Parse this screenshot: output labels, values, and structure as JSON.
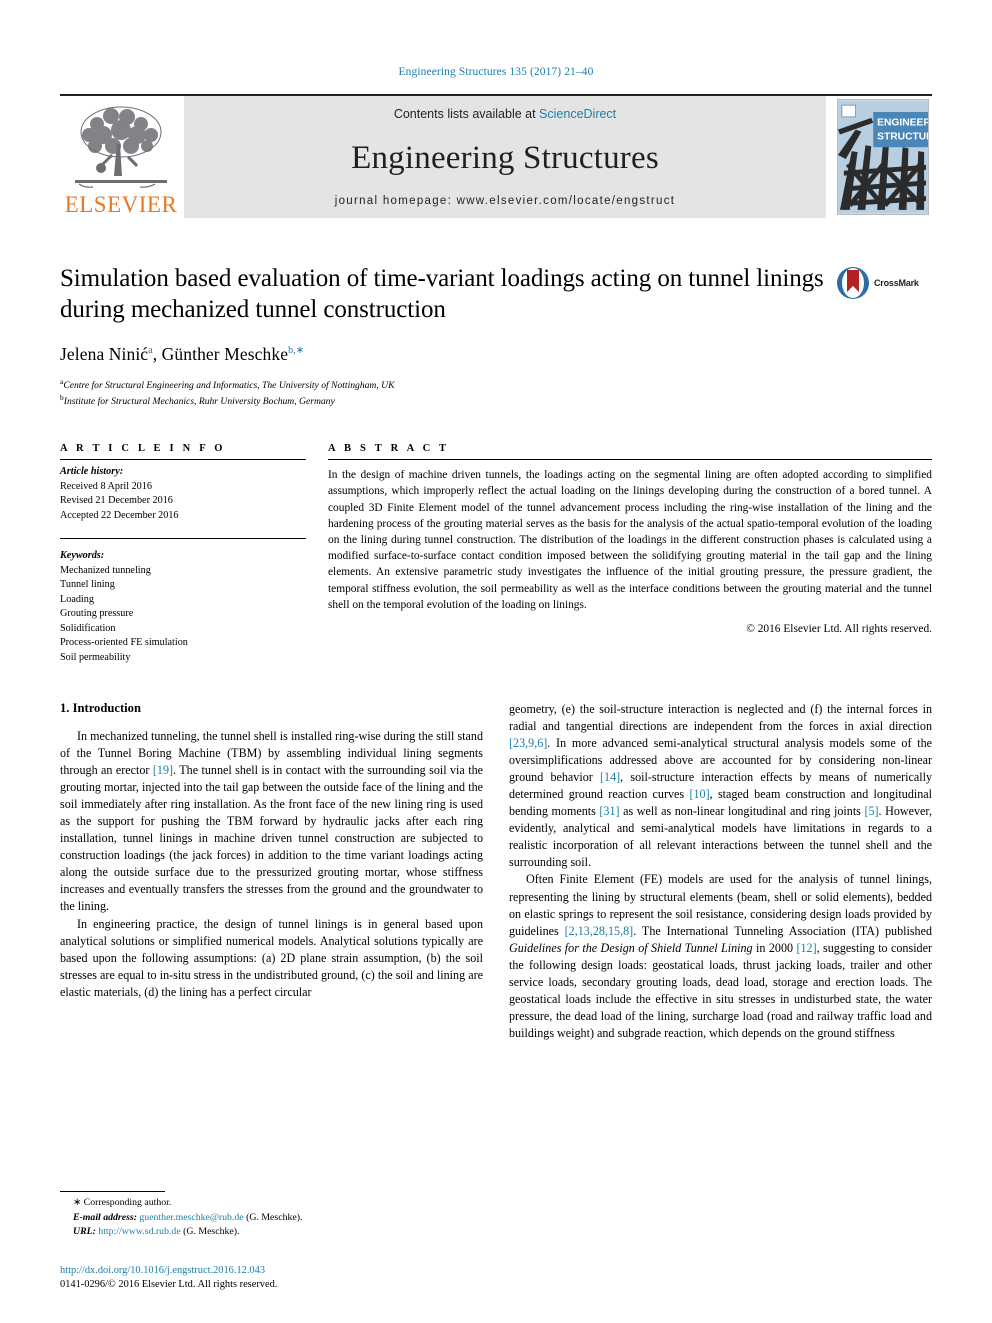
{
  "running_head": "Engineering Structures 135 (2017) 21–40",
  "masthead": {
    "contents_prefix": "Contents lists available at ",
    "sciencedirect": "ScienceDirect",
    "journal_name": "Engineering Structures",
    "homepage_label": "journal homepage: www.elsevier.com/locate/engstruct",
    "publisher_wordmark": "ELSEVIER",
    "cover_title_line1": "ENGINEERING",
    "cover_title_line2": "STRUCTURES",
    "link_color": "#1b7fa8",
    "band_color": "#e4e4e4",
    "elsevier_orange": "#e87722"
  },
  "article": {
    "title": "Simulation based evaluation of time-variant loadings acting on tunnel linings during mechanized tunnel construction",
    "authors_html": "Jelena Ninić<sup>a</sup>, Günther Meschke<sup>b,∗</sup>",
    "affiliation_a": "Centre for Structural Engineering and Informatics, The University of Nottingham, UK",
    "affiliation_b": "Institute for Structural Mechanics, Ruhr University Bochum, Germany",
    "crossmark_label": "CrossMark"
  },
  "article_info": {
    "heading": "A R T I C L E   I N F O",
    "history_label": "Article history:",
    "history": [
      "Received 8 April 2016",
      "Revised 21 December 2016",
      "Accepted 22 December 2016"
    ],
    "keywords_label": "Keywords:",
    "keywords": [
      "Mechanized tunneling",
      "Tunnel lining",
      "Loading",
      "Grouting pressure",
      "Solidification",
      "Process-oriented FE simulation",
      "Soil permeability"
    ]
  },
  "abstract": {
    "heading": "A B S T R A C T",
    "text": "In the design of machine driven tunnels, the loadings acting on the segmental lining are often adopted according to simplified assumptions, which improperly reflect the actual loading on the linings developing during the construction of a bored tunnel. A coupled 3D Finite Element model of the tunnel advancement process including the ring-wise installation of the lining and the hardening process of the grouting material serves as the basis for the analysis of the actual spatio-temporal evolution of the loading on the lining during tunnel construction. The distribution of the loadings in the different construction phases is calculated using a modified surface-to-surface contact condition imposed between the solidifying grouting material in the tail gap and the lining elements. An extensive parametric study investigates the influence of the initial grouting pressure, the pressure gradient, the temporal stiffness evolution, the soil permeability as well as the interface conditions between the grouting material and the tunnel shell on the temporal evolution of the loading on linings.",
    "copyright": "© 2016 Elsevier Ltd. All rights reserved."
  },
  "introduction": {
    "section_title": "1. Introduction",
    "left_paragraphs_html": [
      "In mechanized tunneling, the tunnel shell is installed ring-wise during the still stand of the Tunnel Boring Machine (TBM) by assembling individual lining segments through an erector <span class=\"ref\">[19]</span>. The tunnel shell is in contact with the surrounding soil via the grouting mortar, injected into the tail gap between the outside face of the lining and the soil immediately after ring installation. As the front face of the new lining ring is used as the support for pushing the TBM forward by hydraulic jacks after each ring installation, tunnel linings in machine driven tunnel construction are subjected to construction loadings (the jack forces) in addition to the time variant loadings acting along the outside surface due to the pressurized grouting mortar, whose stiffness increases and eventually transfers the stresses from the ground and the groundwater to the lining.",
      "In engineering practice, the design of tunnel linings is in general based upon analytical solutions or simplified numerical models. Analytical solutions typically are based upon the following assumptions: (a) 2D plane strain assumption, (b) the soil stresses are equal to in-situ stress in the undistributed ground, (c) the soil and lining are elastic materials, (d) the lining has a perfect circular"
    ],
    "right_paragraphs_html": [
      "geometry, (e) the soil-structure interaction is neglected and (f) the internal forces in radial and tangential directions are independent from the forces in axial direction <span class=\"ref\">[23,9,6]</span>. In more advanced semi-analytical structural analysis models some of the oversimplifications addressed above are accounted for by considering non-linear ground behavior <span class=\"ref\">[14]</span>, soil-structure interaction effects by means of numerically determined ground reaction curves <span class=\"ref\">[10]</span>, staged beam construction and longitudinal bending moments <span class=\"ref\">[31]</span> as well as non-linear longitudinal and ring joints <span class=\"ref\">[5]</span>. However, evidently, analytical and semi-analytical models have limitations in regards to a realistic incorporation of all relevant interactions between the tunnel shell and the surrounding soil.",
      "Often Finite Element (FE) models are used for the analysis of tunnel linings, representing the lining by structural elements (beam, shell or solid elements), bedded on elastic springs to represent the soil resistance, considering design loads provided by guidelines <span class=\"ref\">[2,13,28,15,8]</span>. The International Tunneling Association (ITA) published <span class=\"ital\">Guidelines for the Design of Shield Tunnel Lining</span> in 2000 <span class=\"ref\">[12]</span>, suggesting to consider the following design loads: geostatical loads, thrust jacking loads, trailer and other service loads, secondary grouting loads, dead load, storage and erection loads. The geostatical loads include the effective in situ stresses in undisturbed state, the water pressure, the dead load of the lining, surcharge load (road and railway traffic load and buildings weight) and subgrade reaction, which depends on the ground stiffness"
    ]
  },
  "footnote": {
    "corresponding_marker": "∗",
    "corresponding_text": "Corresponding author.",
    "email_label": "E-mail address:",
    "email": "guenther.meschke@rub.de",
    "email_suffix": "(G. Meschke).",
    "url_label": "URL:",
    "url": "http://www.sd.rub.de",
    "url_suffix": "(G. Meschke)."
  },
  "bottom": {
    "doi": "http://dx.doi.org/10.1016/j.engstruct.2016.12.043",
    "issn_line": "0141-0296/© 2016 Elsevier Ltd. All rights reserved."
  }
}
